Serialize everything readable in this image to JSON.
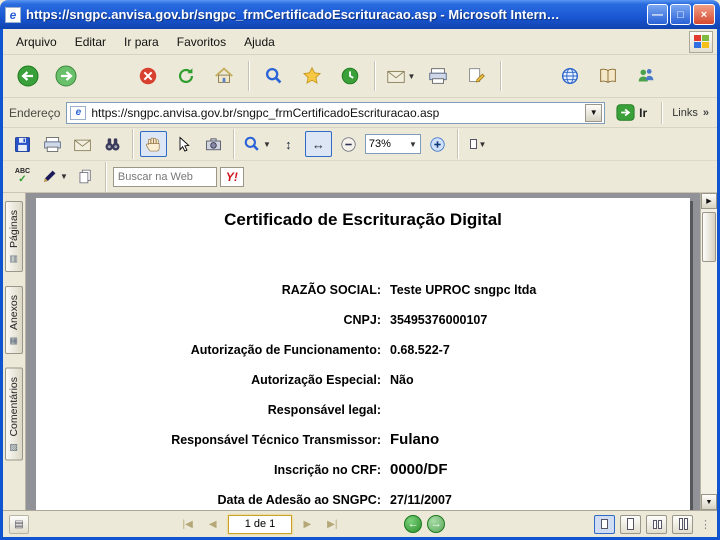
{
  "window": {
    "title": "https://sngpc.anvisa.gov.br/sngpc_frmCertificadoEscrituracao.asp - Microsoft Intern…",
    "controls": [
      "minimize",
      "maximize",
      "close"
    ]
  },
  "menubar": {
    "items": [
      "Arquivo",
      "Editar",
      "Ir para",
      "Favoritos",
      "Ajuda"
    ]
  },
  "browser_toolbar": {
    "icons": [
      "back",
      "forward",
      "stop",
      "refresh",
      "home",
      "search",
      "favorites",
      "history",
      "mail",
      "print",
      "edit",
      "discuss",
      "research",
      "messenger"
    ]
  },
  "addressbar": {
    "label": "Endereço",
    "url": "https://sngpc.anvisa.gov.br/sngpc_frmCertificadoEscrituracao.asp",
    "go": "Ir",
    "links": "Links",
    "overflow": "»"
  },
  "pdf_toolbar": {
    "zoom": "73%",
    "spell_label": "ABC",
    "icons_row1": [
      "save",
      "print",
      "email",
      "search-binoculars",
      "hand-tool",
      "select-tool",
      "snapshot",
      "zoom-tool",
      "fit-height",
      "fit-width",
      "zoom-out",
      "zoom-in",
      "page-layout"
    ],
    "icons_row2": [
      "spellcheck",
      "sign",
      "copy"
    ]
  },
  "yahoo": {
    "search_text": "Buscar na Web",
    "logo": "Y!"
  },
  "sidebar": {
    "tabs": [
      {
        "label": "Páginas"
      },
      {
        "label": "Anexos"
      },
      {
        "label": "Comentários"
      }
    ]
  },
  "document": {
    "title": "Certificado de Escrituração Digital",
    "fields": [
      {
        "label": "RAZÃO SOCIAL:",
        "value": "Teste UPROC sngpc ltda"
      },
      {
        "label": "CNPJ:",
        "value": "35495376000107"
      },
      {
        "label": "Autorização de Funcionamento:",
        "value": "0.68.522-7"
      },
      {
        "label": "Autorização Especial:",
        "value": "Não"
      },
      {
        "label": "Responsável legal:",
        "value": ""
      },
      {
        "label": "Responsável Técnico Transmissor:",
        "value": "Fulano"
      },
      {
        "label": "Inscrição no CRF:",
        "value": "0000/DF"
      },
      {
        "label": "Data de Adesão ao SNGPC:",
        "value": "27/11/2007"
      }
    ]
  },
  "statusbar": {
    "page_indicator": "1 de 1"
  },
  "colors": {
    "titlebar_blue": "#1956d2",
    "toolbar_beige": "#ece9d8",
    "close_red": "#d6492f",
    "viewport_gray": "#909298",
    "go_green": "#3aa03a"
  }
}
